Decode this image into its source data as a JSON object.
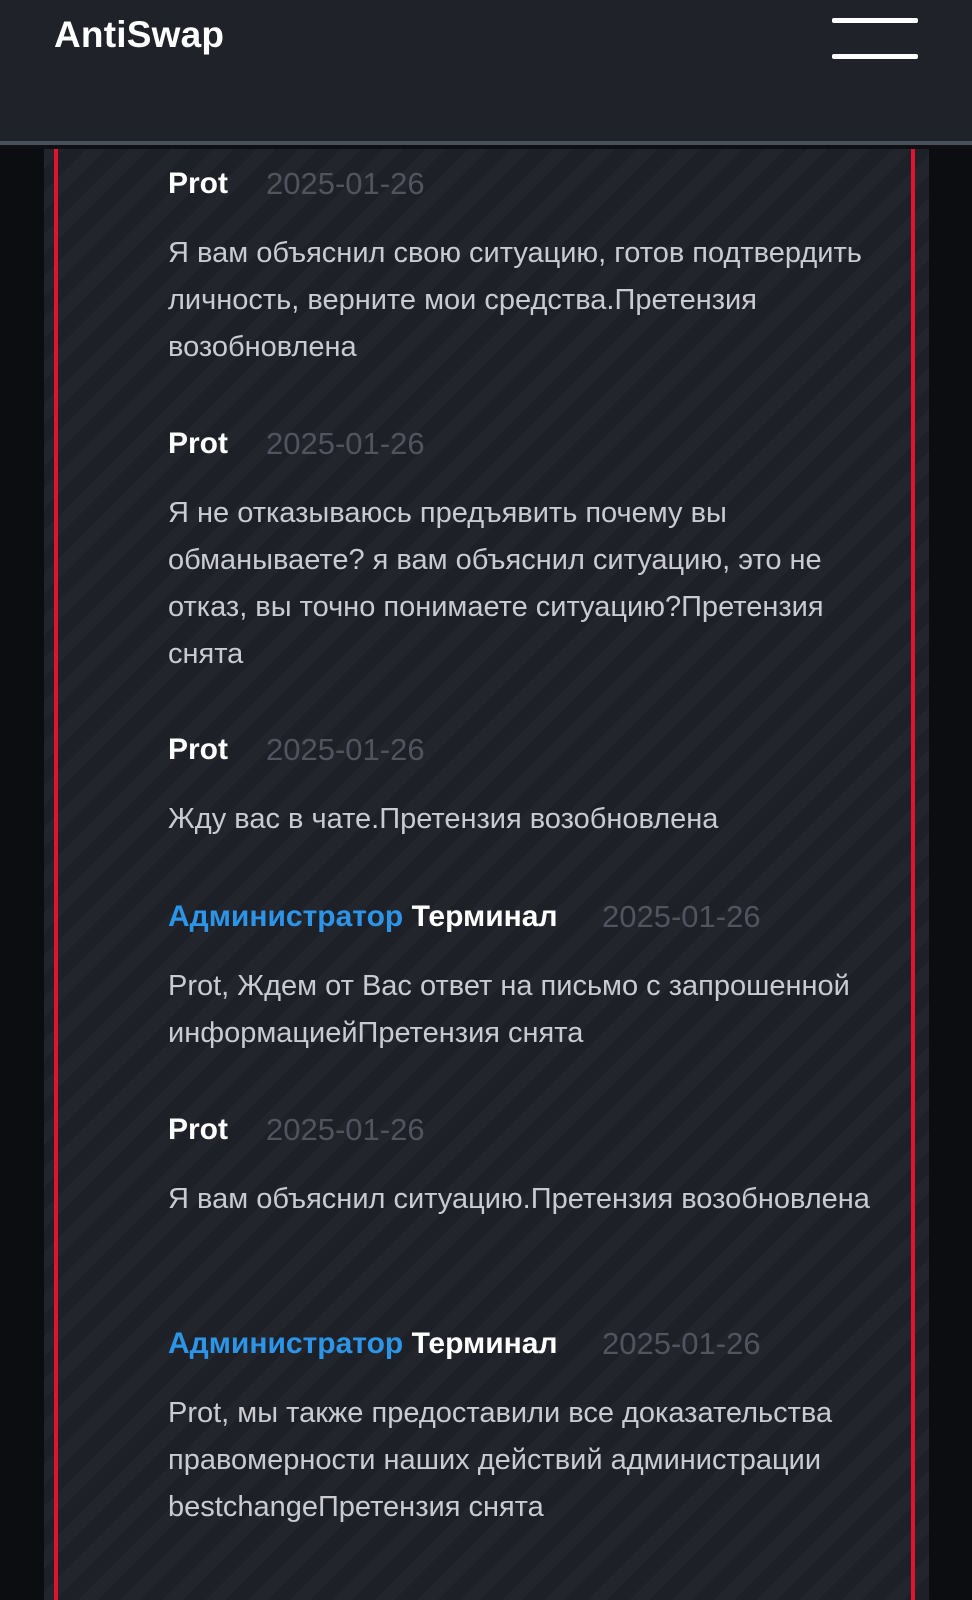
{
  "header": {
    "brand": "AntiSwap",
    "menu_icon": "hamburger-menu-icon"
  },
  "colors": {
    "accent_border": "#e0142f",
    "admin_role": "#2c95e8",
    "header_bg": "#1f2229",
    "panel_bg": "#1e2027"
  },
  "messages": [
    {
      "role": "",
      "author": "Prot",
      "date": "2025-01-26",
      "text": "Я вам объяснил свою ситуацию, готов подтвердить личность, верните мои средства.Претензия возобновлена"
    },
    {
      "role": "",
      "author": "Prot",
      "date": "2025-01-26",
      "text": "Я не отказываюсь предъявить почему вы обманываете? я вам объяснил ситуацию, это не отказ, вы точно понимаете ситуацию?Претензия снята"
    },
    {
      "role": "",
      "author": "Prot",
      "date": "2025-01-26",
      "text": "Жду вас в чате.Претензия возобновлена"
    },
    {
      "role": "Администратор",
      "author": "Терминал",
      "date": "2025-01-26",
      "text": "Prot, Ждем от Вас ответ на письмо с запрошенной информациейПретензия снята"
    },
    {
      "role": "",
      "author": "Prot",
      "date": "2025-01-26",
      "text": "Я вам объяснил ситуацию.Претензия возобновлена"
    },
    {
      "role": "Администратор",
      "author": "Терминал",
      "date": "2025-01-26",
      "text": "Prot, мы также предоставили все доказательства правомерности наших действий администрации bestchangeПретензия снята"
    }
  ]
}
